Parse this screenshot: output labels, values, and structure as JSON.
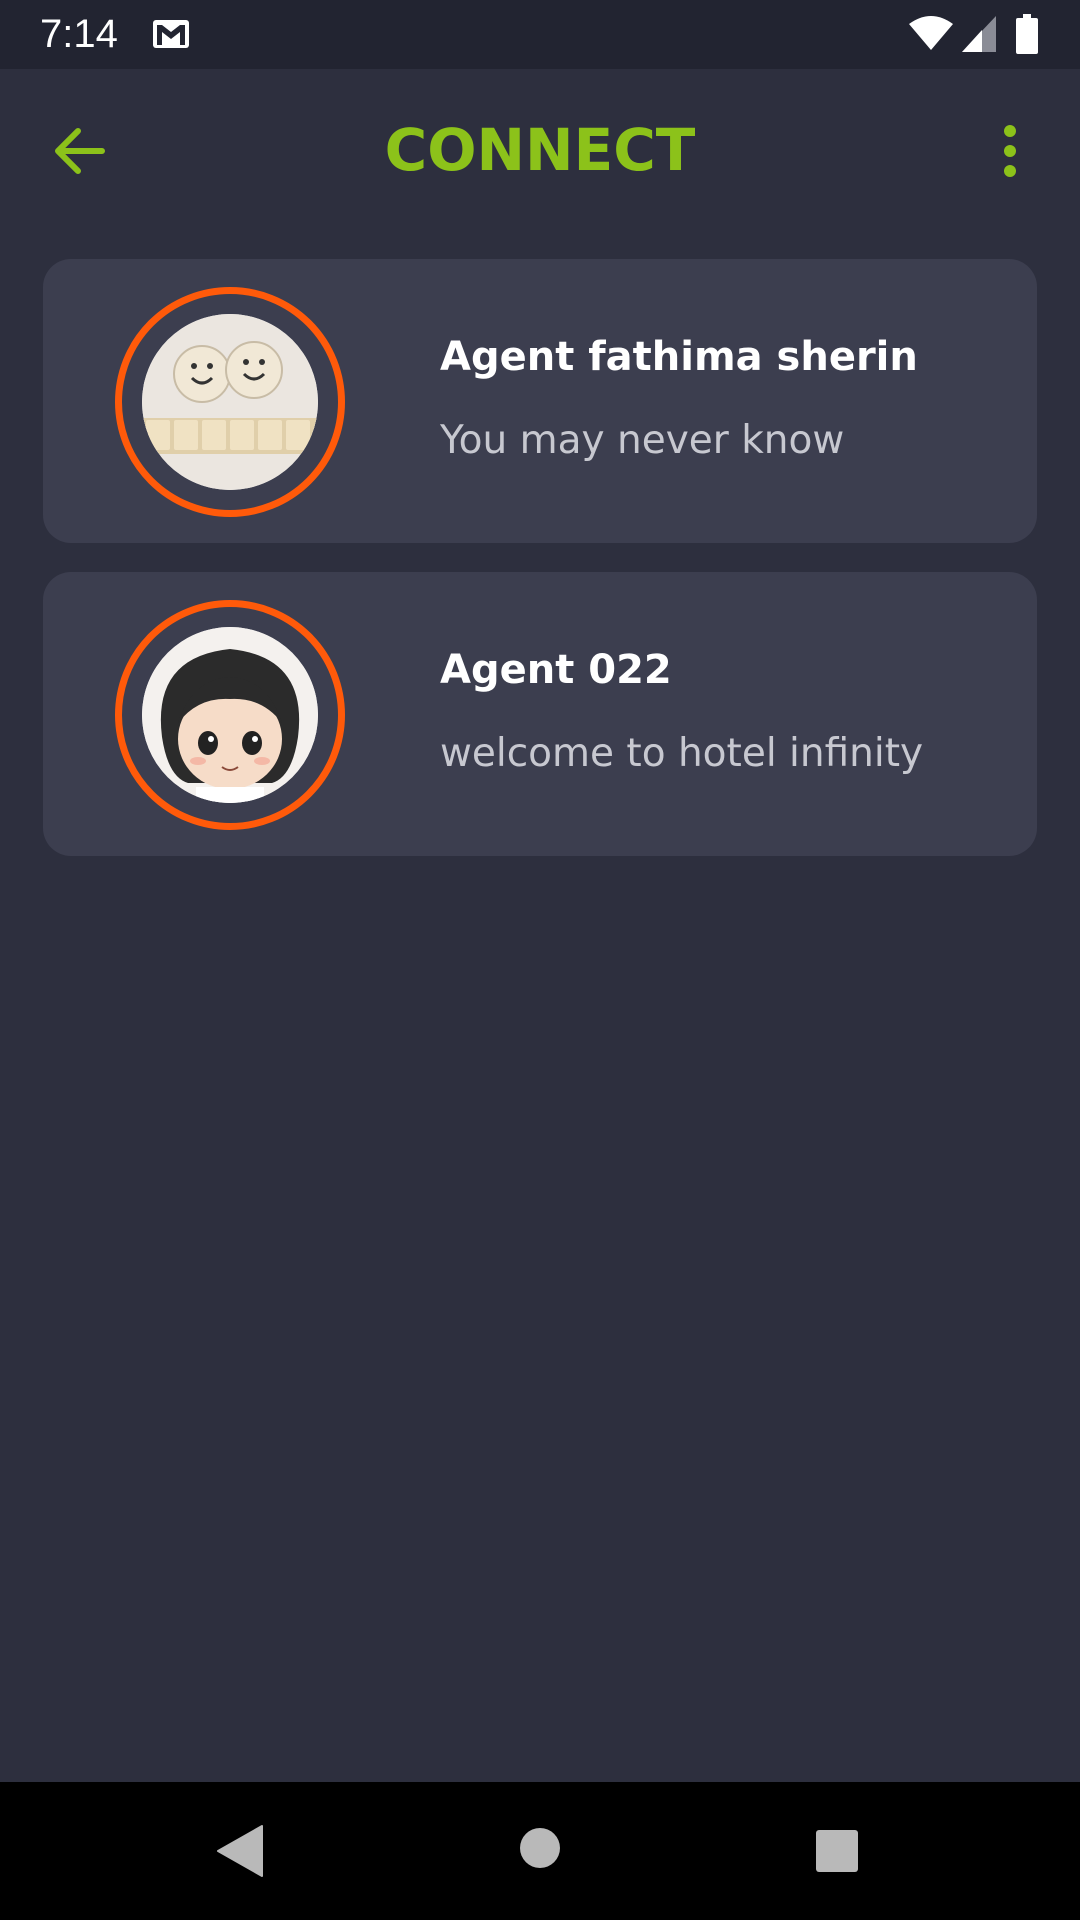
{
  "status_bar": {
    "time": "7:14",
    "icons": [
      "gmail-icon",
      "wifi-icon",
      "signal-icon",
      "battery-icon"
    ]
  },
  "app_bar": {
    "title": "CONNECT",
    "back_icon": "arrow-back-icon",
    "menu_icon": "more-vert-icon"
  },
  "contacts": [
    {
      "name": "Agent fathima sherin",
      "status": "You may never know",
      "avatar": "friend-dice-avatar"
    },
    {
      "name": "Agent 022",
      "status": "welcome to hotel infinity",
      "avatar": "cartoon-girl-avatar"
    }
  ],
  "colors": {
    "background": "#2d2f3e",
    "card": "#3c3e4f",
    "accent": "#8cc21a",
    "avatar_ring": "#ff5a0a",
    "status_bar": "#222431"
  },
  "nav_bar": {
    "icons": [
      "nav-back-icon",
      "nav-home-icon",
      "nav-recents-icon"
    ]
  }
}
